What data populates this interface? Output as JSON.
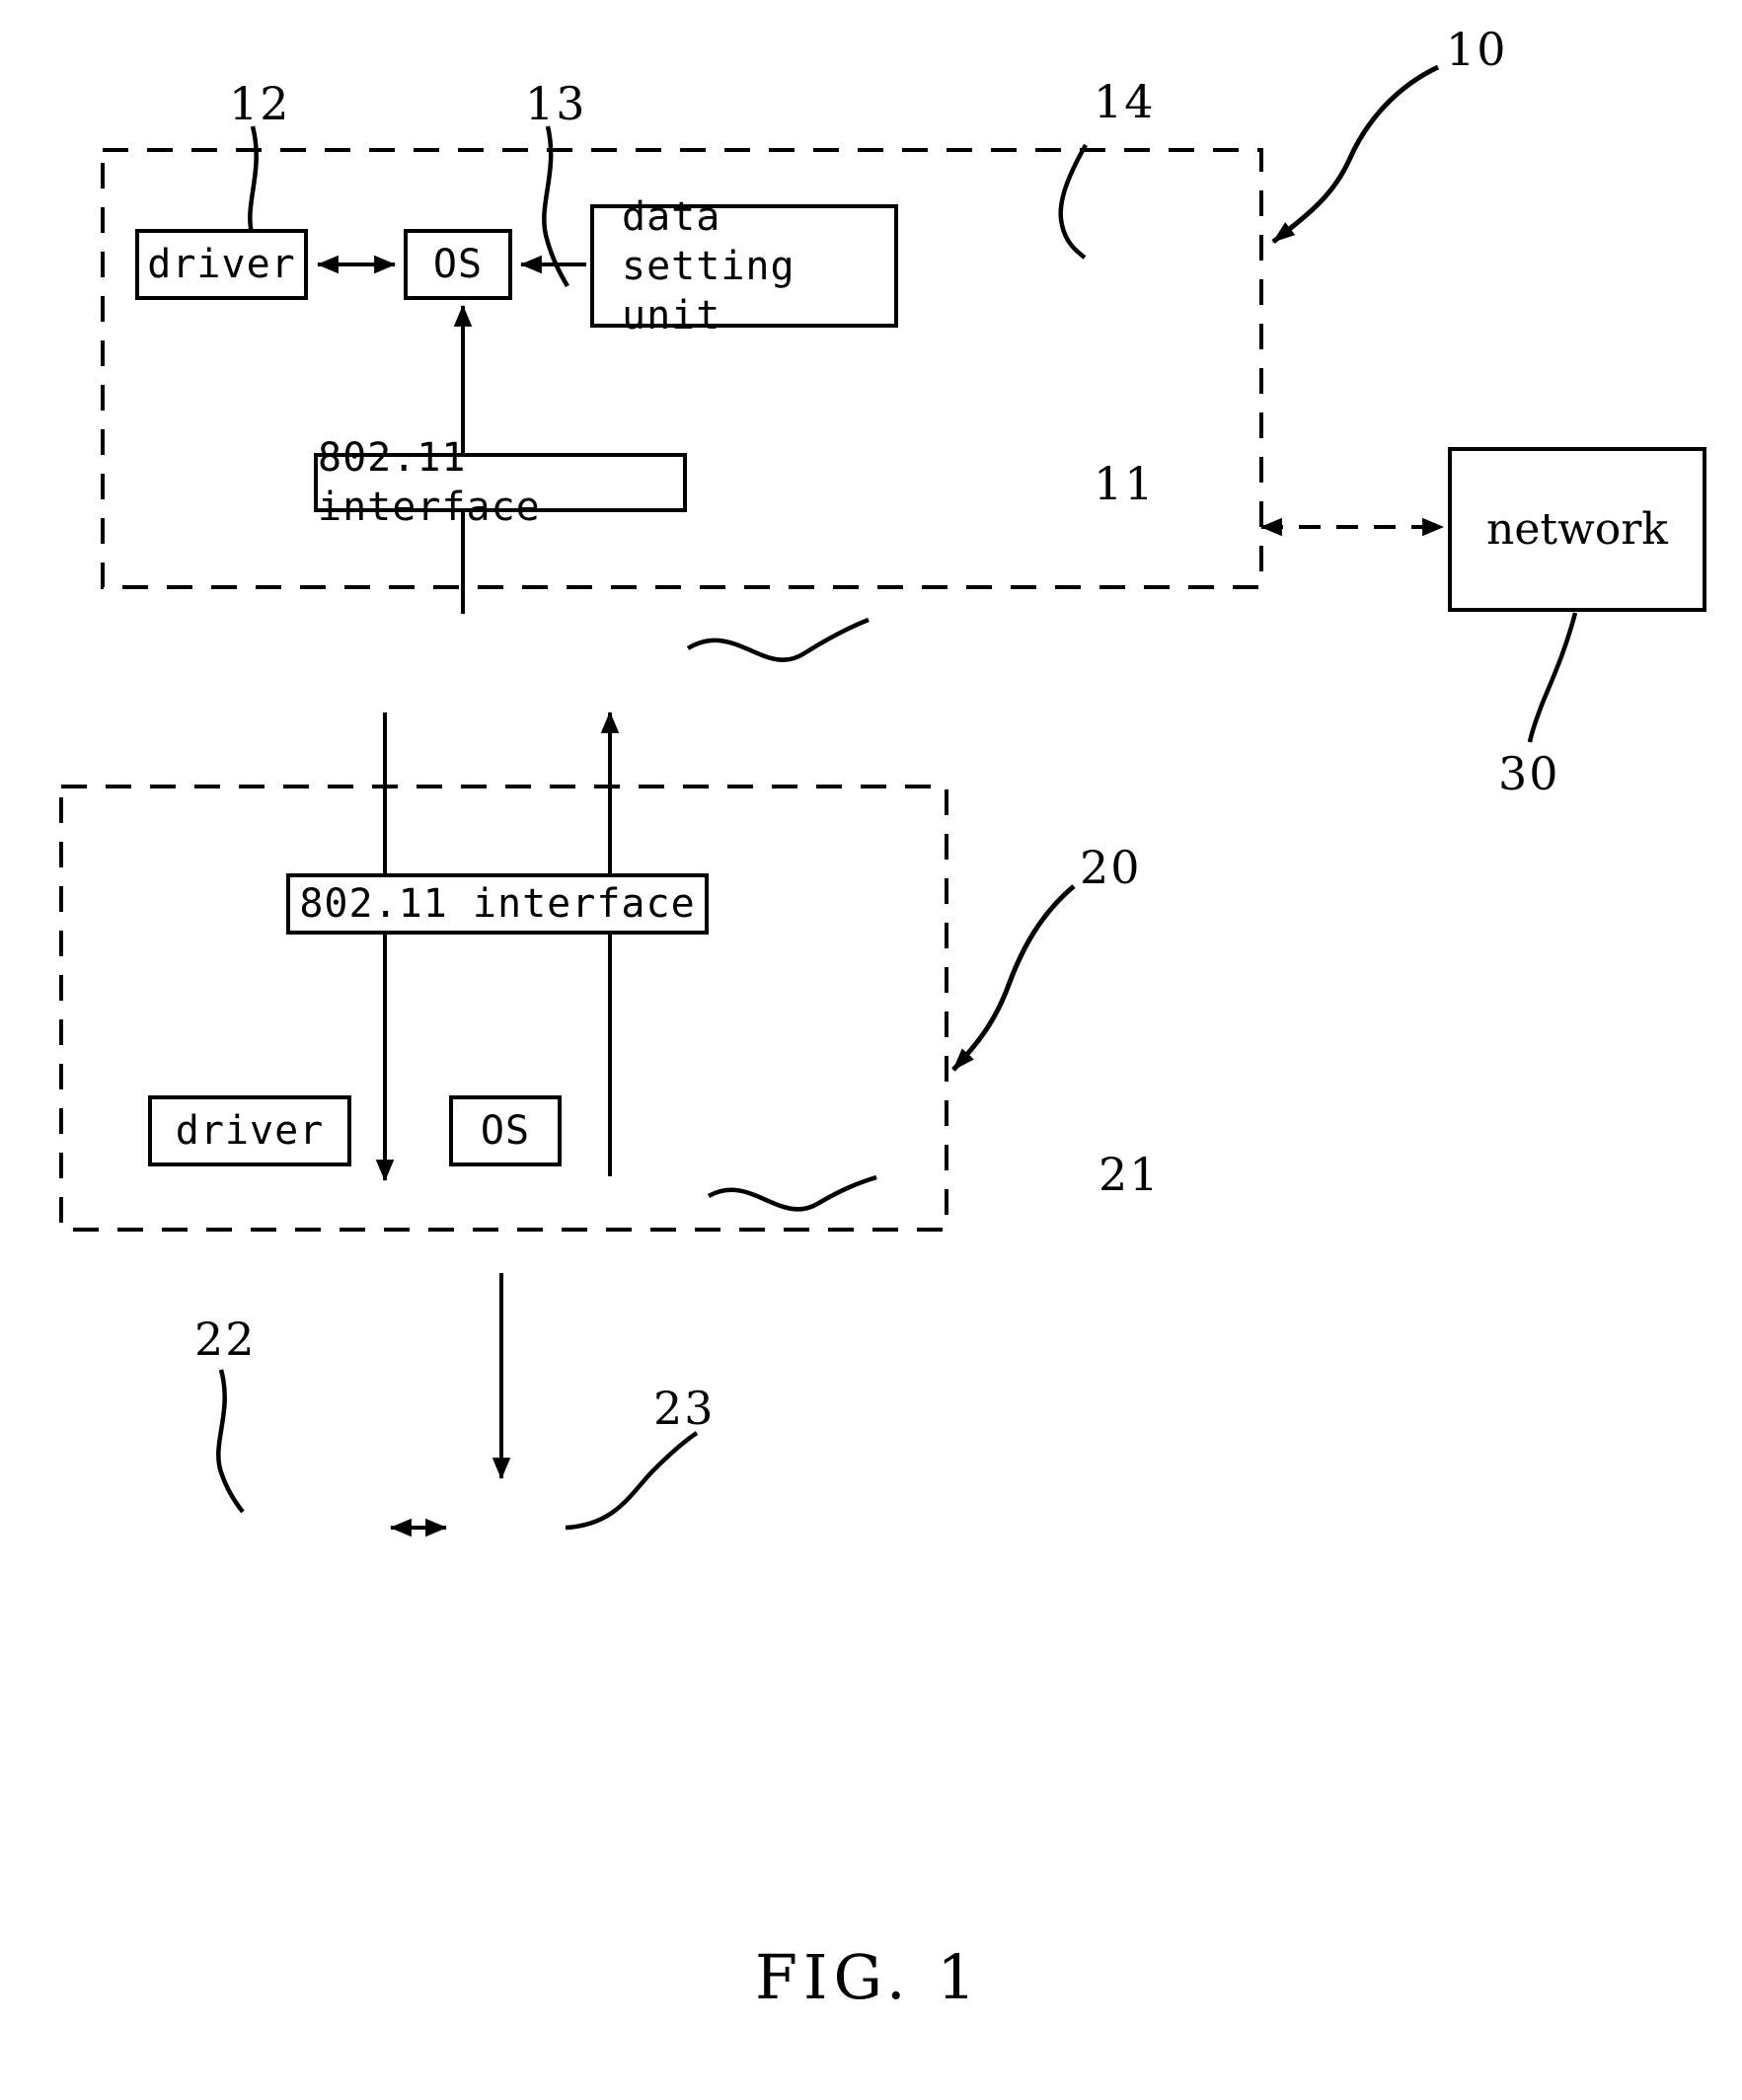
{
  "figure": {
    "caption": "FIG. 1",
    "type": "patent-block-diagram"
  },
  "containers": [
    {
      "id": "station-10",
      "ref": "10",
      "style": "dashed-rectangle"
    },
    {
      "id": "station-20",
      "ref": "20",
      "style": "dashed-rectangle"
    }
  ],
  "blocks": {
    "driver_top": {
      "label": "driver",
      "ref": "12"
    },
    "os_top": {
      "label": "OS",
      "ref": "13"
    },
    "data_setting_unit": {
      "label": "data\nsetting unit",
      "ref": "14"
    },
    "interface_top": {
      "label": "802.11 interface",
      "ref": "11"
    },
    "network": {
      "label": "network",
      "ref": "30"
    },
    "interface_bottom": {
      "label": "802.11 interface",
      "ref": "21"
    },
    "driver_bottom": {
      "label": "driver",
      "ref": "22"
    },
    "os_bottom": {
      "label": "OS",
      "ref": "23"
    }
  },
  "ref_numbers": {
    "n10": "10",
    "n11": "11",
    "n12": "12",
    "n13": "13",
    "n14": "14",
    "n20": "20",
    "n21": "21",
    "n22": "22",
    "n23": "23",
    "n30": "30"
  },
  "colors": {
    "ink": "#000000",
    "paper": "#ffffff"
  }
}
